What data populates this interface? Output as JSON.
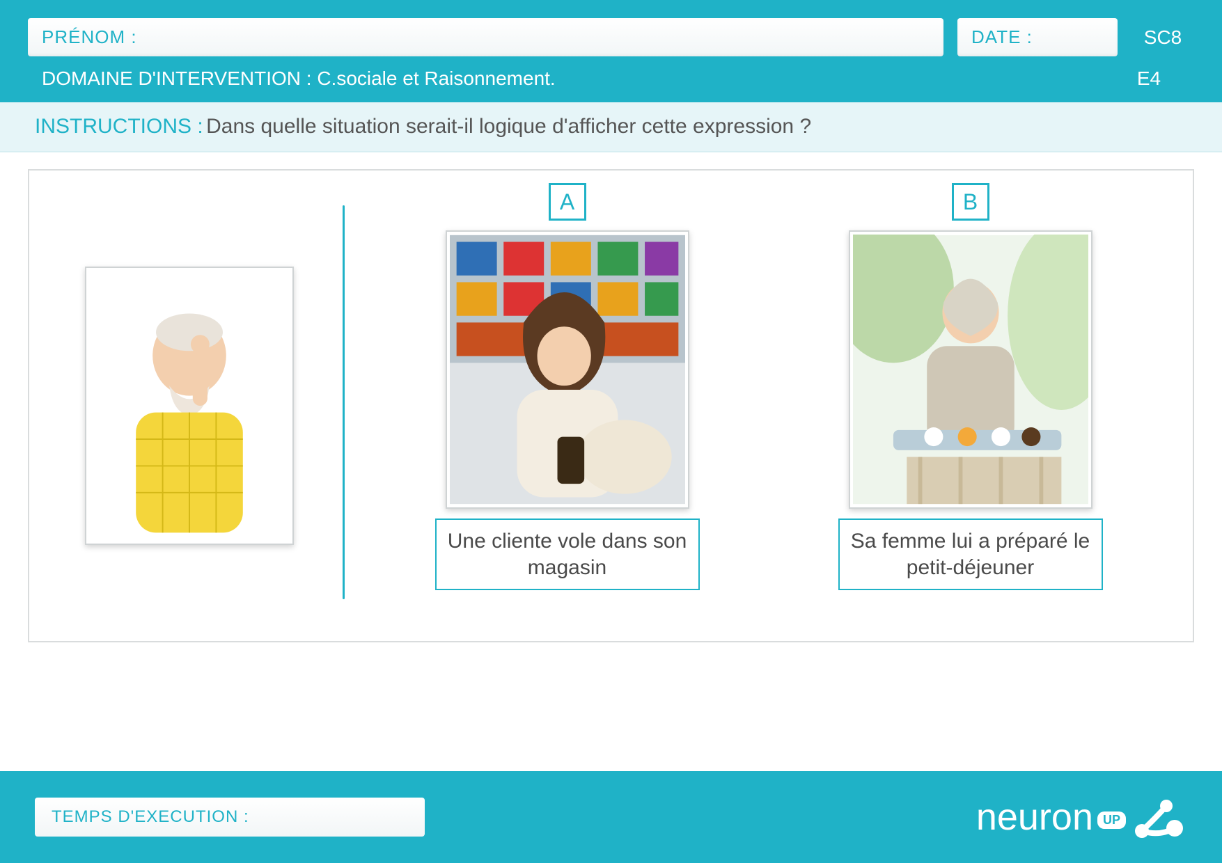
{
  "header": {
    "prenom_label": "PRÉNOM :",
    "date_label": "DATE :",
    "sheet_code": "SC8",
    "domain_label": "DOMAINE D'INTERVENTION :",
    "domain_value": "C.sociale et Raisonnement.",
    "level_code": "E4"
  },
  "instructions": {
    "label": "INSTRUCTIONS :",
    "text": "Dans quelle situation serait-il logique d'afficher cette expression ?"
  },
  "exercise": {
    "expression_alt": "Homme âgé levant l'index d'un air réprobateur",
    "options": [
      {
        "letter": "A",
        "caption": "Une cliente vole dans son magasin",
        "alt": "Femme mettant un article dans son sac dans un magasin"
      },
      {
        "letter": "B",
        "caption": "Sa femme lui a préparé le petit-déjeuner",
        "alt": "Femme souriante portant un plateau de petit-déjeuner"
      }
    ]
  },
  "footer": {
    "exec_label": "TEMPS D'EXECUTION :",
    "brand_name": "neuron",
    "brand_badge": "UP"
  },
  "colors": {
    "teal": "#1fb2c7",
    "teal_light": "#e6f5f8"
  }
}
